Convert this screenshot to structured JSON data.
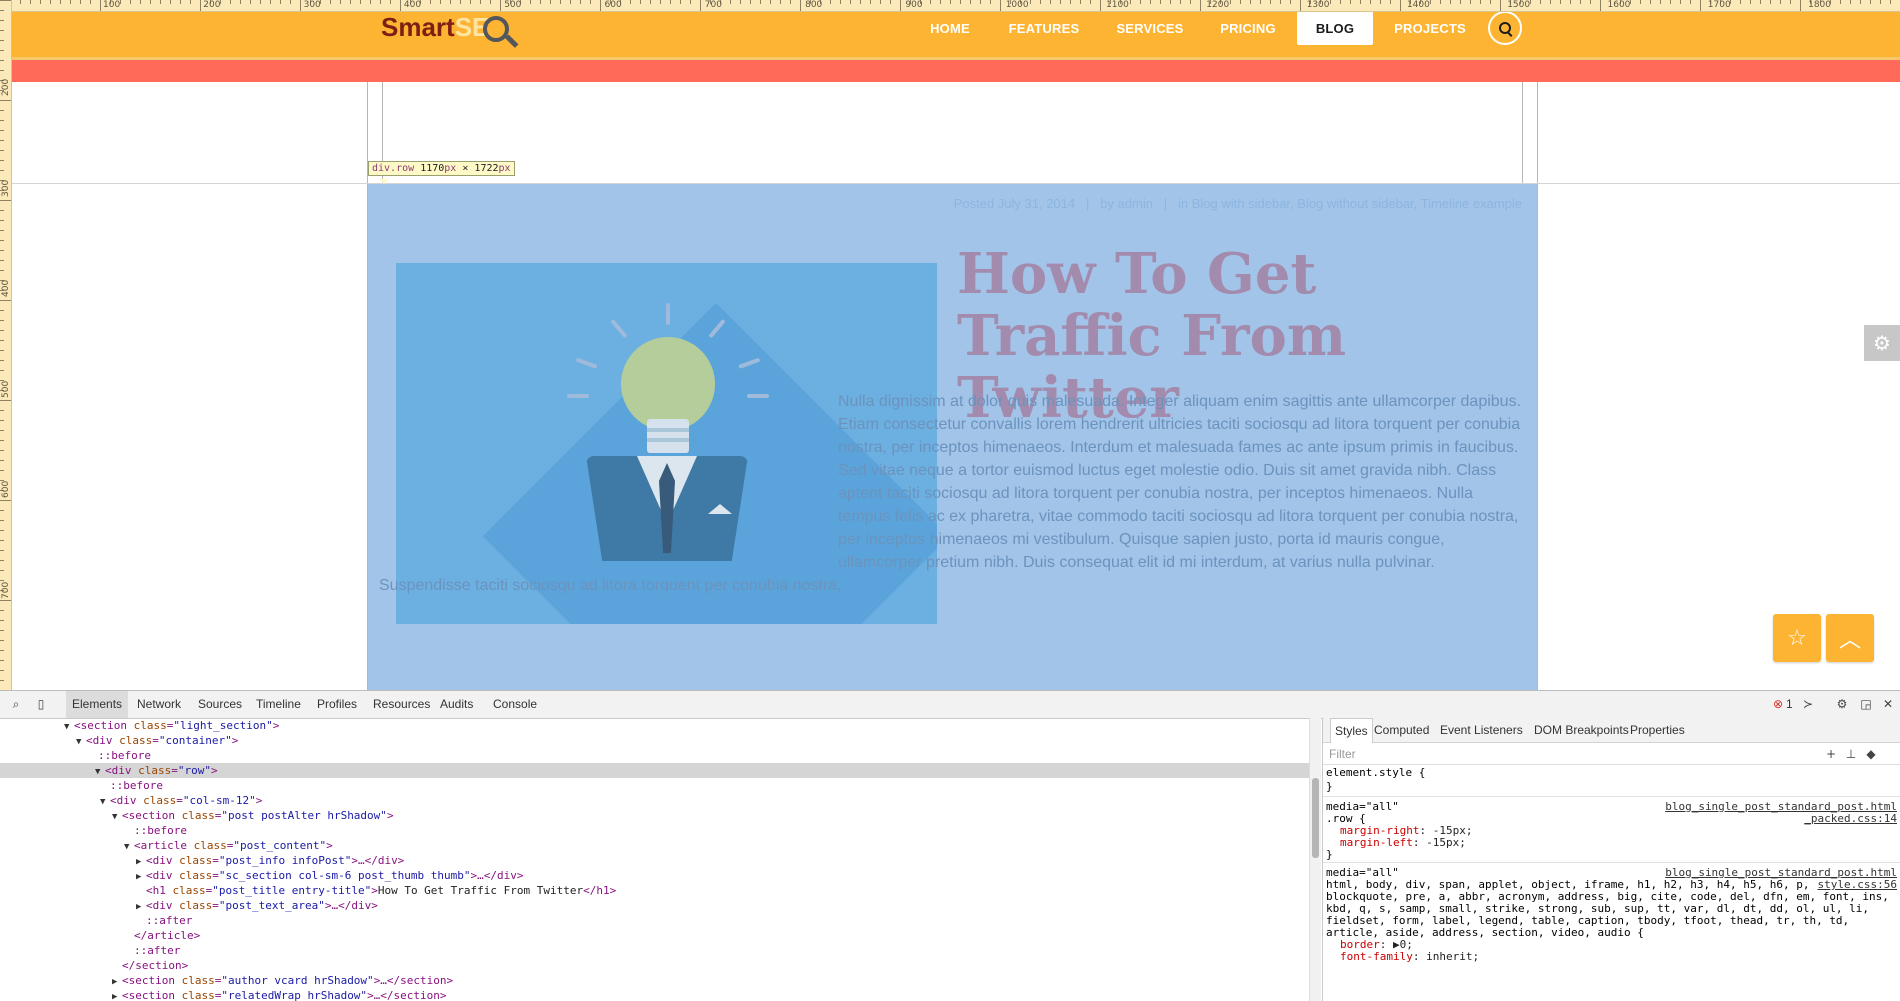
{
  "ruler": {
    "top_labels": [
      "100",
      "200",
      "300",
      "400",
      "500",
      "600",
      "700",
      "800",
      "900",
      "1000",
      "1100",
      "1200",
      "1300",
      "1400",
      "1500",
      "1600",
      "1700",
      "1800"
    ],
    "left_labels": [
      "200",
      "300",
      "400",
      "500",
      "600",
      "700"
    ]
  },
  "site": {
    "logo_main": "Smart",
    "logo_accent": "SE",
    "nav": [
      "HOME",
      "FEATURES",
      "SERVICES",
      "PRICING",
      "BLOG",
      "PROJECTS"
    ],
    "active_nav": "BLOG",
    "colors": {
      "navbar": "#fdb433",
      "redbar": "#ff6b58",
      "highlight": "#a2c4e9"
    }
  },
  "inspector": {
    "element_name": "div.row",
    "width": "1170",
    "height": "1722",
    "unit": "px",
    "times": "×"
  },
  "post": {
    "meta_posted": "Posted July 31, 2014",
    "meta_sep1": "|",
    "meta_by": "by admin",
    "meta_sep2": "|",
    "meta_in": "in Blog with sidebar, Blog without sidebar, Timeline example",
    "title": "How To Get Traffic From Twitter",
    "body": "Nulla dignissim at dolor quis malesuada. Integer aliquam enim sagittis ante ullamcorper dapibus. Etiam consectetur convallis lorem hendrerit ultricies taciti sociosqu ad litora torquent per conubia nostra, per inceptos himenaeos. Interdum et malesuada fames ac ante ipsum primis in faucibus. Sed vitae neque a tortor euismod luctus eget molestie odio. Duis sit amet gravida nibh. Class aptent taciti sociosqu ad litora torquent per conubia nostra, per inceptos himenaeos. Nulla tempus felis ac ex pharetra, vitae commodo taciti sociosqu ad litora torquent per conubia nostra, per inceptos himenaeos mi vestibulum. Quisque sapien justo, porta id mauris congue, ullamcorper pretium nibh. Duis consequat elit id mi interdum, at varius nulla pulvinar. Suspendisse taciti sociosqu ad litora torquent per conubia nostra,"
  },
  "floating": {
    "gear_icon": "gear-icon",
    "star_icon": "star-icon",
    "up_icon": "chevron-up-icon"
  },
  "devtools": {
    "tabs": [
      "Elements",
      "Network",
      "Sources",
      "Timeline",
      "Profiles",
      "Resources",
      "Audits",
      "Console"
    ],
    "active_tab": "Elements",
    "error_count": "1",
    "dom": [
      {
        "indent": 0,
        "tri": "▼",
        "open": "<section",
        "attr": "class",
        "val": "\"light_section\"",
        "close": ">"
      },
      {
        "indent": 1,
        "tri": "▼",
        "open": "<div",
        "attr": "class",
        "val": "\"container\"",
        "close": ">"
      },
      {
        "indent": 2,
        "tri": "",
        "pseudo": "::before"
      },
      {
        "indent": 2,
        "tri": "▼",
        "open": "<div",
        "attr": "class",
        "val": "\"row\"",
        "close": ">",
        "selected": true
      },
      {
        "indent": 3,
        "tri": "",
        "pseudo": "::before"
      },
      {
        "indent": 3,
        "tri": "▼",
        "open": "<div",
        "attr": "class",
        "val": "\"col-sm-12\"",
        "close": ">"
      },
      {
        "indent": 4,
        "tri": "▼",
        "open": "<section",
        "attr": "class",
        "val": "\"post postAlter hrShadow\"",
        "close": ">"
      },
      {
        "indent": 5,
        "tri": "",
        "pseudo": "::before"
      },
      {
        "indent": 5,
        "tri": "▼",
        "open": "<article",
        "attr": "class",
        "val": "\"post_content\"",
        "close": ">"
      },
      {
        "indent": 6,
        "tri": "▶",
        "open": "<div",
        "attr": "class",
        "val": "\"post_info infoPost\"",
        "close": ">…</div>"
      },
      {
        "indent": 6,
        "tri": "▶",
        "open": "<div",
        "attr": "class",
        "val": "\"sc_section col-sm-6 post_thumb thumb\"",
        "close": ">…</div>"
      },
      {
        "indent": 6,
        "tri": "",
        "open": "<h1",
        "attr": "class",
        "val": "\"post_title entry-title\"",
        "close": ">",
        "text": "How To Get Traffic From Twitter",
        "end": "</h1>"
      },
      {
        "indent": 6,
        "tri": "▶",
        "open": "<div",
        "attr": "class",
        "val": "\"post_text_area\"",
        "close": ">…</div>"
      },
      {
        "indent": 6,
        "tri": "",
        "pseudo": "::after"
      },
      {
        "indent": 5,
        "tri": "",
        "endtag": "</article>"
      },
      {
        "indent": 5,
        "tri": "",
        "pseudo": "::after"
      },
      {
        "indent": 4,
        "tri": "",
        "endtag": "</section>"
      },
      {
        "indent": 4,
        "tri": "▶",
        "open": "<section",
        "attr": "class",
        "val": "\"author vcard hrShadow\"",
        "close": ">…</section>"
      },
      {
        "indent": 4,
        "tri": "▶",
        "open": "<section",
        "attr": "class",
        "val": "\"relatedWrap hrShadow\"",
        "close": ">…</section>"
      }
    ],
    "style_tabs": [
      "Styles",
      "Computed",
      "Event Listeners",
      "DOM Breakpoints",
      "Properties"
    ],
    "filter_placeholder": "Filter",
    "rules": [
      {
        "lines": [
          "element.style {",
          "}"
        ]
      },
      {
        "media": "media=\"all\"",
        "link": "blog_single_post_standard_post.html",
        "link2": "_packed.css:14",
        "selector": ".row {",
        "props": [
          [
            "margin-right",
            "-15px;"
          ],
          [
            "margin-left",
            "-15px;"
          ]
        ],
        "end": "}"
      },
      {
        "media": "media=\"all\"",
        "link": "blog_single_post_standard_post.html",
        "link2": "style.css:56",
        "selector_lines": [
          "html, body, div, span, applet, object, iframe, h1, h2, h3, h4, h5, h6, p,",
          "blockquote, pre, a, abbr, acronym, address, big, cite, code, del, dfn, em, font, ins,",
          "kbd, q, s, samp, small, strike, strong, sub, sup, tt, var, dl, dt, dd, ol, ul, li,",
          "fieldset, form, label, legend, table, caption, tbody, tfoot, thead, tr, th, td,",
          "article, aside, address, section, video, audio {"
        ],
        "props": [
          [
            "border",
            "▶0;"
          ],
          [
            "font-family",
            "inherit;"
          ]
        ]
      }
    ]
  }
}
